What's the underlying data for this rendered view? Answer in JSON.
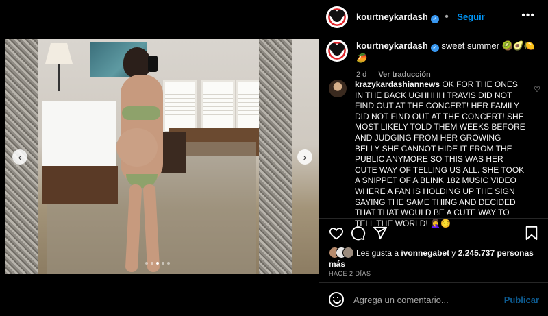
{
  "post": {
    "username": "kourtneykardash",
    "follow_label": "Seguir",
    "more_label": "•••",
    "caption": "sweet summer 🥝🥑🍋🥭",
    "age": "2 d",
    "translate_label": "Ver traducción"
  },
  "comment": {
    "username": "krazykardashiannews",
    "text": "OK FOR THE ONES IN THE BACK UGHHHH TRAVIS DID NOT FIND OUT AT THE CONCERT! HER FAMILY DID NOT FIND OUT AT THE CONCERT! SHE MOST LIKELY TOLD THEM WEEKS BEFORE AND JUDGING FROM HER GROWING BELLY SHE CANNOT HIDE IT FROM THE PUBLIC ANYMORE SO THIS WAS HER CUTE WAY OF TELLING US ALL. SHE TOOK A SNIPPET OF A BLINK 182 MUSIC VIDEO WHERE A FAN IS HOLDING UP THE SIGN SAYING THE SAME THING AND DECIDED THAT THAT WOULD BE A CUTE WAY TO TELL THE WORLD! 🤦‍♀️😏"
  },
  "likes": {
    "prefix": "Les gusta a ",
    "user": "ivonnegabet",
    "middle": " y ",
    "count": "2.245.737 personas más"
  },
  "timestamp": "HACE 2 DÍAS",
  "add_comment": {
    "placeholder": "Agrega un comentario...",
    "publish_label": "Publicar"
  },
  "carousel": {
    "total_slides": 5,
    "active_slide": 3
  },
  "icons": {
    "heart": "heart-icon",
    "comment": "comment-icon",
    "share": "share-icon",
    "save": "bookmark-icon",
    "emoji": "emoji-icon"
  },
  "colors": {
    "background": "#000000",
    "link_blue": "#0095f6",
    "verified_blue": "#3897f0",
    "muted_text": "#a8a8a8"
  }
}
